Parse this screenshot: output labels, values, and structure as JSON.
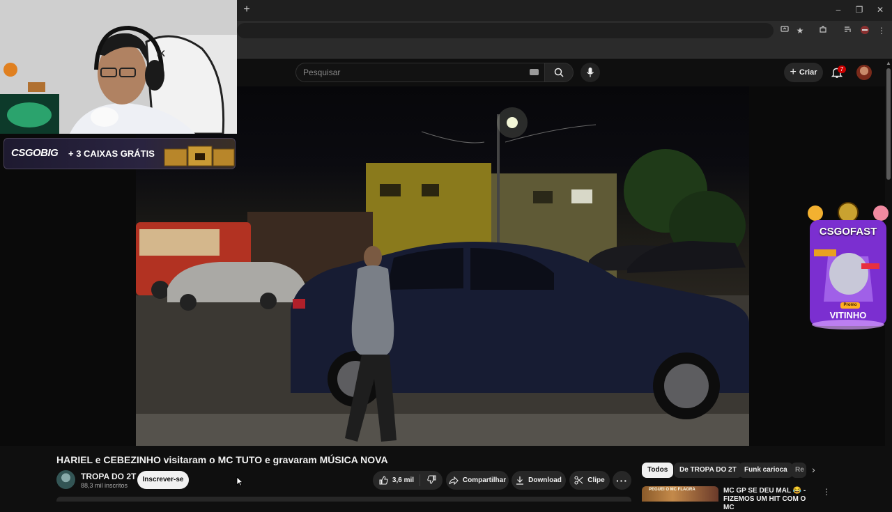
{
  "browser": {
    "new_tab_symbol": "+",
    "window_controls": [
      "–",
      "❐",
      "✕"
    ]
  },
  "header": {
    "search_placeholder": "Pesquisar",
    "create_label": "Criar",
    "notification_count": "7"
  },
  "webcam_overlay": {
    "headset_brand": "IK",
    "banner_brand": "CSGOBIG",
    "banner_offer": "+ 3 CAIXAS GRÁTIS"
  },
  "side_ad": {
    "brand": "CSGOFAST",
    "tag": "Promo",
    "user": "VITINHO"
  },
  "video": {
    "title": "HARIEL e CEBEZINHO visitaram o MC TUTO e gravaram MÚSICA NOVA",
    "channel_name": "TROPA DO 2T",
    "subscribers": "88,3 mil inscritos",
    "subscribe_label": "Inscrever-se",
    "likes": "3,6 mil",
    "share_label": "Compartilhar",
    "download_label": "Download",
    "clip_label": "Clipe",
    "more_label": "···"
  },
  "chips": [
    "Todos",
    "De TROPA DO 2T",
    "Funk carioca",
    "Re"
  ],
  "recommendation": {
    "thumbnail_text": "PEGUEI O MC FLAGRA",
    "title": "MC GP SE DEU MAL 😂 - FIZEMOS UM HIT COM O MC"
  },
  "colors": {
    "background": "#0f0f0f",
    "chip_active": "#f1f1f1",
    "notification": "#cc0000",
    "ad_purple": "#7b2fd0"
  }
}
